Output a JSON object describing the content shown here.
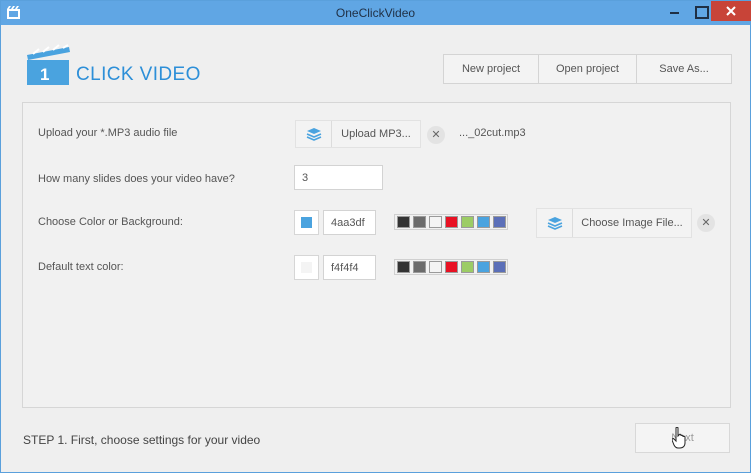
{
  "window": {
    "title": "OneClickVideo"
  },
  "logo": {
    "badge": "1",
    "text": "CLICK VIDEO"
  },
  "toolbar": {
    "new_project": "New project",
    "open_project": "Open project",
    "save_as": "Save As..."
  },
  "audio": {
    "label": "Upload your *.MP3 audio file",
    "button": "Upload MP3...",
    "file_name": "..._02cut.mp3"
  },
  "slides": {
    "label": "How many slides does your video have?",
    "value": "3"
  },
  "background": {
    "label": "Choose Color or Background:",
    "hex": "4aa3df",
    "color": "#4aa3df",
    "image_button": "Choose Image File..."
  },
  "text_color": {
    "label": "Default text color:",
    "hex": "f4f4f4",
    "color": "#f4f4f4"
  },
  "palette_colors": [
    "#333333",
    "#6b6b6b",
    "#f4f4f4",
    "#e81123",
    "#9ccc65",
    "#4aa3df",
    "#5b6fb8"
  ],
  "footer": {
    "step_text": "STEP 1. First, choose settings for your video",
    "next": "Next"
  }
}
